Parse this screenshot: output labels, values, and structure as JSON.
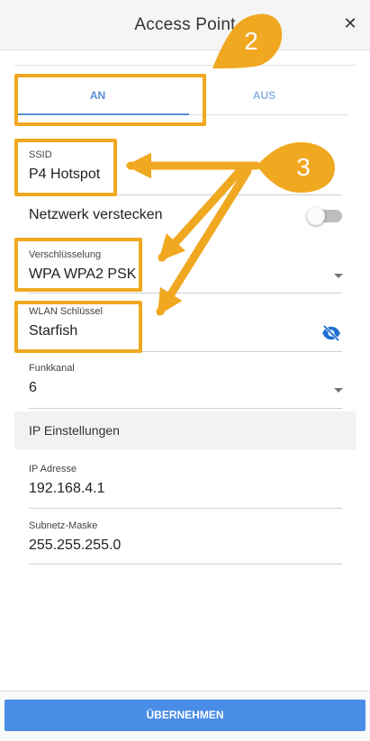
{
  "header": {
    "title": "Access Point",
    "close_icon": "close-icon"
  },
  "tabs": [
    {
      "label": "AN",
      "active": true
    },
    {
      "label": "AUS",
      "active": false
    }
  ],
  "ssid": {
    "label": "SSID",
    "value": "P4 Hotspot"
  },
  "hide_network": {
    "label": "Netzwerk verstecken",
    "enabled": false
  },
  "encryption": {
    "label": "Verschlüsselung",
    "value": "WPA WPA2 PSK"
  },
  "wlan_key": {
    "label": "WLAN Schlüssel",
    "value": "Starfish",
    "visibility_icon": "eye-off-icon"
  },
  "channel": {
    "label": "Funkkanal",
    "value": "6"
  },
  "ip_section": {
    "title": "IP Einstellungen"
  },
  "ip_address": {
    "label": "IP Adresse",
    "value": "192.168.4.1"
  },
  "subnet": {
    "label": "Subnetz-Maske",
    "value": "255.255.255.0"
  },
  "footer": {
    "apply_label": "ÜBERNEHMEN"
  },
  "annotations": {
    "callout_2": "2",
    "callout_3": "3",
    "color": "#f0a820"
  },
  "colors": {
    "accent": "#5b8fd8",
    "button": "#4a8de6",
    "highlight": "#f0a820"
  }
}
